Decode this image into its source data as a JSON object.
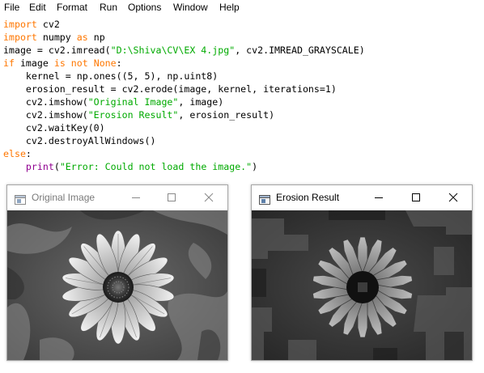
{
  "menu": [
    "File",
    "Edit",
    "Format",
    "Run",
    "Options",
    "Window",
    "Help"
  ],
  "code": {
    "l1_kw": "import",
    "l1_rest": " cv2",
    "l2_kw": "import",
    "l2_mid": " numpy ",
    "l2_kw2": "as",
    "l2_rest": " np",
    "l3_a": "image = cv2.imread(",
    "l3_str": "\"D:\\Shiva\\CV\\EX 4.jpg\"",
    "l3_b": ", cv2.IMREAD_GRAYSCALE)",
    "l4_kw": "if",
    "l4_mid": " image ",
    "l4_kw2": "is not",
    "l4_sp": " ",
    "l4_kw3": "None",
    "l4_end": ":",
    "l5": "    kernel = np.ones((5, 5), np.uint8)",
    "l6": "    erosion_result = cv2.erode(image, kernel, iterations=1)",
    "l7_a": "    cv2.imshow(",
    "l7_str": "\"Original Image\"",
    "l7_b": ", image)",
    "l8_a": "    cv2.imshow(",
    "l8_str": "\"Erosion Result\"",
    "l8_b": ", erosion_result)",
    "l9": "    cv2.waitKey(0)",
    "l10": "    cv2.destroyAllWindows()",
    "l11_kw": "else",
    "l11_end": ":",
    "l12_pre": "    ",
    "l12_bi": "print",
    "l12_a": "(",
    "l12_str": "\"Error: Could not load the image.\"",
    "l12_b": ")"
  },
  "windows": {
    "original": {
      "title": "Original Image",
      "icons": [
        "app-window-icon",
        "minimize-icon",
        "maximize-icon",
        "close-icon"
      ]
    },
    "erosion": {
      "title": "Erosion Result",
      "icons": [
        "app-window-icon",
        "minimize-icon",
        "maximize-icon",
        "close-icon"
      ]
    }
  },
  "colors": {
    "keyword": "#ff7700",
    "string": "#00aa00",
    "builtin": "#900090",
    "inactive_title_text": "#7a7a7a",
    "active_title_text": "#000000"
  }
}
